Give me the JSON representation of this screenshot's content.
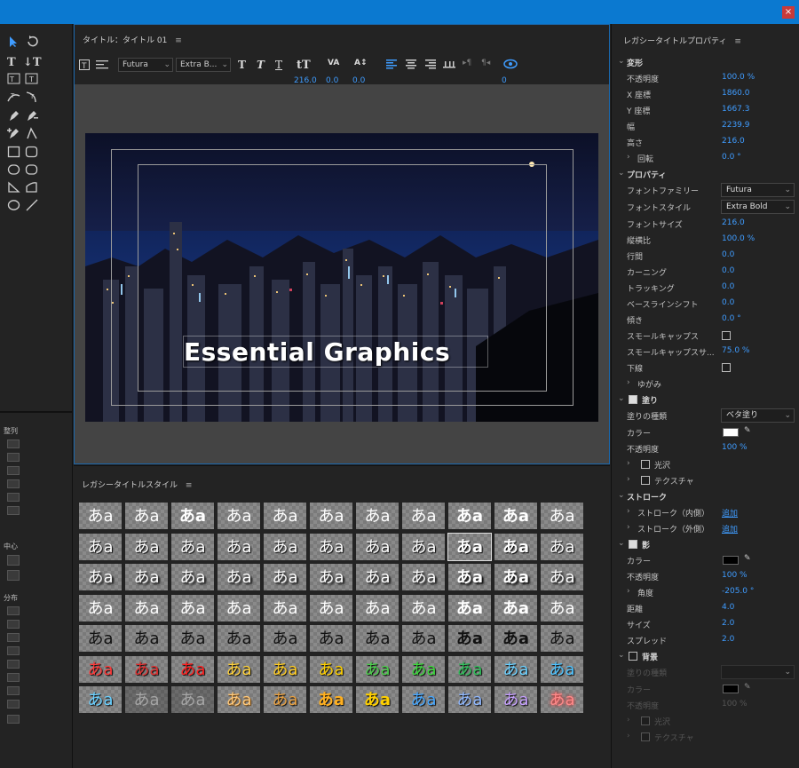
{
  "window": {
    "close_glyph": "×",
    "accent": "#0b79d0"
  },
  "title_panel": {
    "title": "タイトル：タイトル 01",
    "menu_glyph": "≡",
    "font_family": "Futura",
    "font_style": "Extra B...",
    "values": [
      "216.0",
      "0.0",
      "0.0",
      "0"
    ],
    "graphic_text": "Essential Graphics"
  },
  "left_panel": {
    "align_label": "整列",
    "center_label": "中心",
    "distribute_label": "分布"
  },
  "styles_panel": {
    "title": "レガシータイトルスタイル",
    "menu_glyph": "≡",
    "sample": "あa"
  },
  "properties": {
    "title": "レガシータイトルプロパティ",
    "menu_glyph": "≡",
    "transform": {
      "header": "変形",
      "opacity_label": "不透明度",
      "opacity": "100.0 %",
      "x_label": "X 座標",
      "x": "1860.0",
      "y_label": "Y 座標",
      "y": "1667.3",
      "width_label": "幅",
      "width": "2239.9",
      "height_label": "高さ",
      "height": "216.0",
      "rotation_label": "回転",
      "rotation": "0.0 °"
    },
    "props": {
      "header": "プロパティ",
      "font_family_label": "フォントファミリー",
      "font_family": "Futura",
      "font_style_label": "フォントスタイル",
      "font_style": "Extra Bold",
      "font_size_label": "フォントサイズ",
      "font_size": "216.0",
      "aspect_label": "縦横比",
      "aspect": "100.0 %",
      "leading_label": "行間",
      "leading": "0.0",
      "kerning_label": "カーニング",
      "kerning": "0.0",
      "tracking_label": "トラッキング",
      "tracking": "0.0",
      "baseline_label": "ベースラインシフト",
      "baseline": "0.0",
      "slant_label": "傾き",
      "slant": "0.0 °",
      "smallcaps_label": "スモールキャップス",
      "smallcaps_size_label": "スモールキャップスサ...",
      "smallcaps_size": "75.0 %",
      "underline_label": "下線",
      "distort_label": "ゆがみ"
    },
    "fill": {
      "header": "塗り",
      "fill_type_label": "塗りの種類",
      "fill_type": "ベタ塗り",
      "color_label": "カラー",
      "color": "#ffffff",
      "opacity_label": "不透明度",
      "opacity": "100 %",
      "sheen_label": "光沢",
      "texture_label": "テクスチャ"
    },
    "stroke": {
      "header": "ストローク",
      "inner_label": "ストローク（内側）",
      "outer_label": "ストローク（外側）",
      "add_label": "追加"
    },
    "shadow": {
      "header": "影",
      "color_label": "カラー",
      "color": "#000000",
      "opacity_label": "不透明度",
      "opacity": "100 %",
      "angle_label": "角度",
      "angle": "-205.0 °",
      "distance_label": "距離",
      "distance": "4.0",
      "size_label": "サイズ",
      "size": "2.0",
      "spread_label": "スプレッド",
      "spread": "2.0"
    },
    "background": {
      "header": "背景",
      "fill_type_label": "塗りの種類",
      "color_label": "カラー",
      "opacity_label": "不透明度",
      "opacity": "100 %",
      "sheen_label": "光沢",
      "texture_label": "テクスチャ"
    }
  }
}
